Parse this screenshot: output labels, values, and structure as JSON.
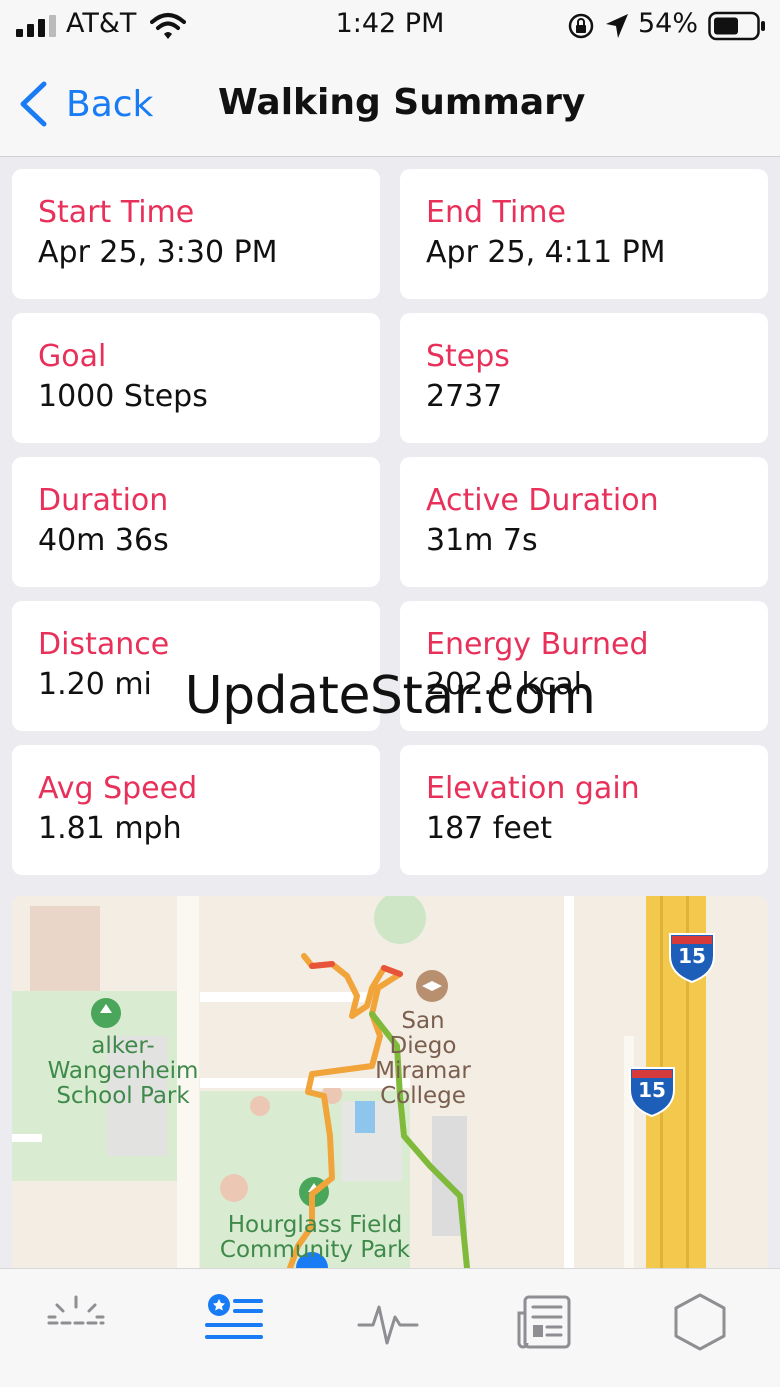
{
  "status_bar": {
    "carrier": "AT&T",
    "time": "1:42 PM",
    "battery_percent": "54%"
  },
  "nav": {
    "back_label": "Back",
    "title": "Walking Summary"
  },
  "cards": [
    {
      "label": "Start Time",
      "value": "Apr 25, 3:30 PM"
    },
    {
      "label": "End Time",
      "value": "Apr 25, 4:11 PM"
    },
    {
      "label": "Goal",
      "value": "1000 Steps"
    },
    {
      "label": "Steps",
      "value": "2737"
    },
    {
      "label": "Duration",
      "value": "40m 36s"
    },
    {
      "label": "Active Duration",
      "value": "31m 7s"
    },
    {
      "label": "Distance",
      "value": "1.20 mi"
    },
    {
      "label": "Energy Burned",
      "value": "202.0 kcal"
    },
    {
      "label": "Avg Speed",
      "value": "1.81 mph"
    },
    {
      "label": "Elevation gain",
      "value": "187 feet"
    }
  ],
  "map": {
    "label_park_1": "alker-Wangenheim",
    "label_park_2": "School Park",
    "label_college_1": "San Diego",
    "label_college_2": "Miramar",
    "label_college_3": "College",
    "label_field_1": "Hourglass Field",
    "label_field_2": "Community Park",
    "highway_shield": "15"
  },
  "watermark": "UpdateStar.com",
  "tabs": [
    {
      "name": "sun-icon"
    },
    {
      "name": "workout-list-icon",
      "active": true
    },
    {
      "name": "heart-rate-icon"
    },
    {
      "name": "news-icon"
    },
    {
      "name": "hexagon-icon"
    }
  ],
  "colors": {
    "accent_blue": "#1a7cf5",
    "label_red": "#e8315a",
    "background": "#ececf0"
  }
}
